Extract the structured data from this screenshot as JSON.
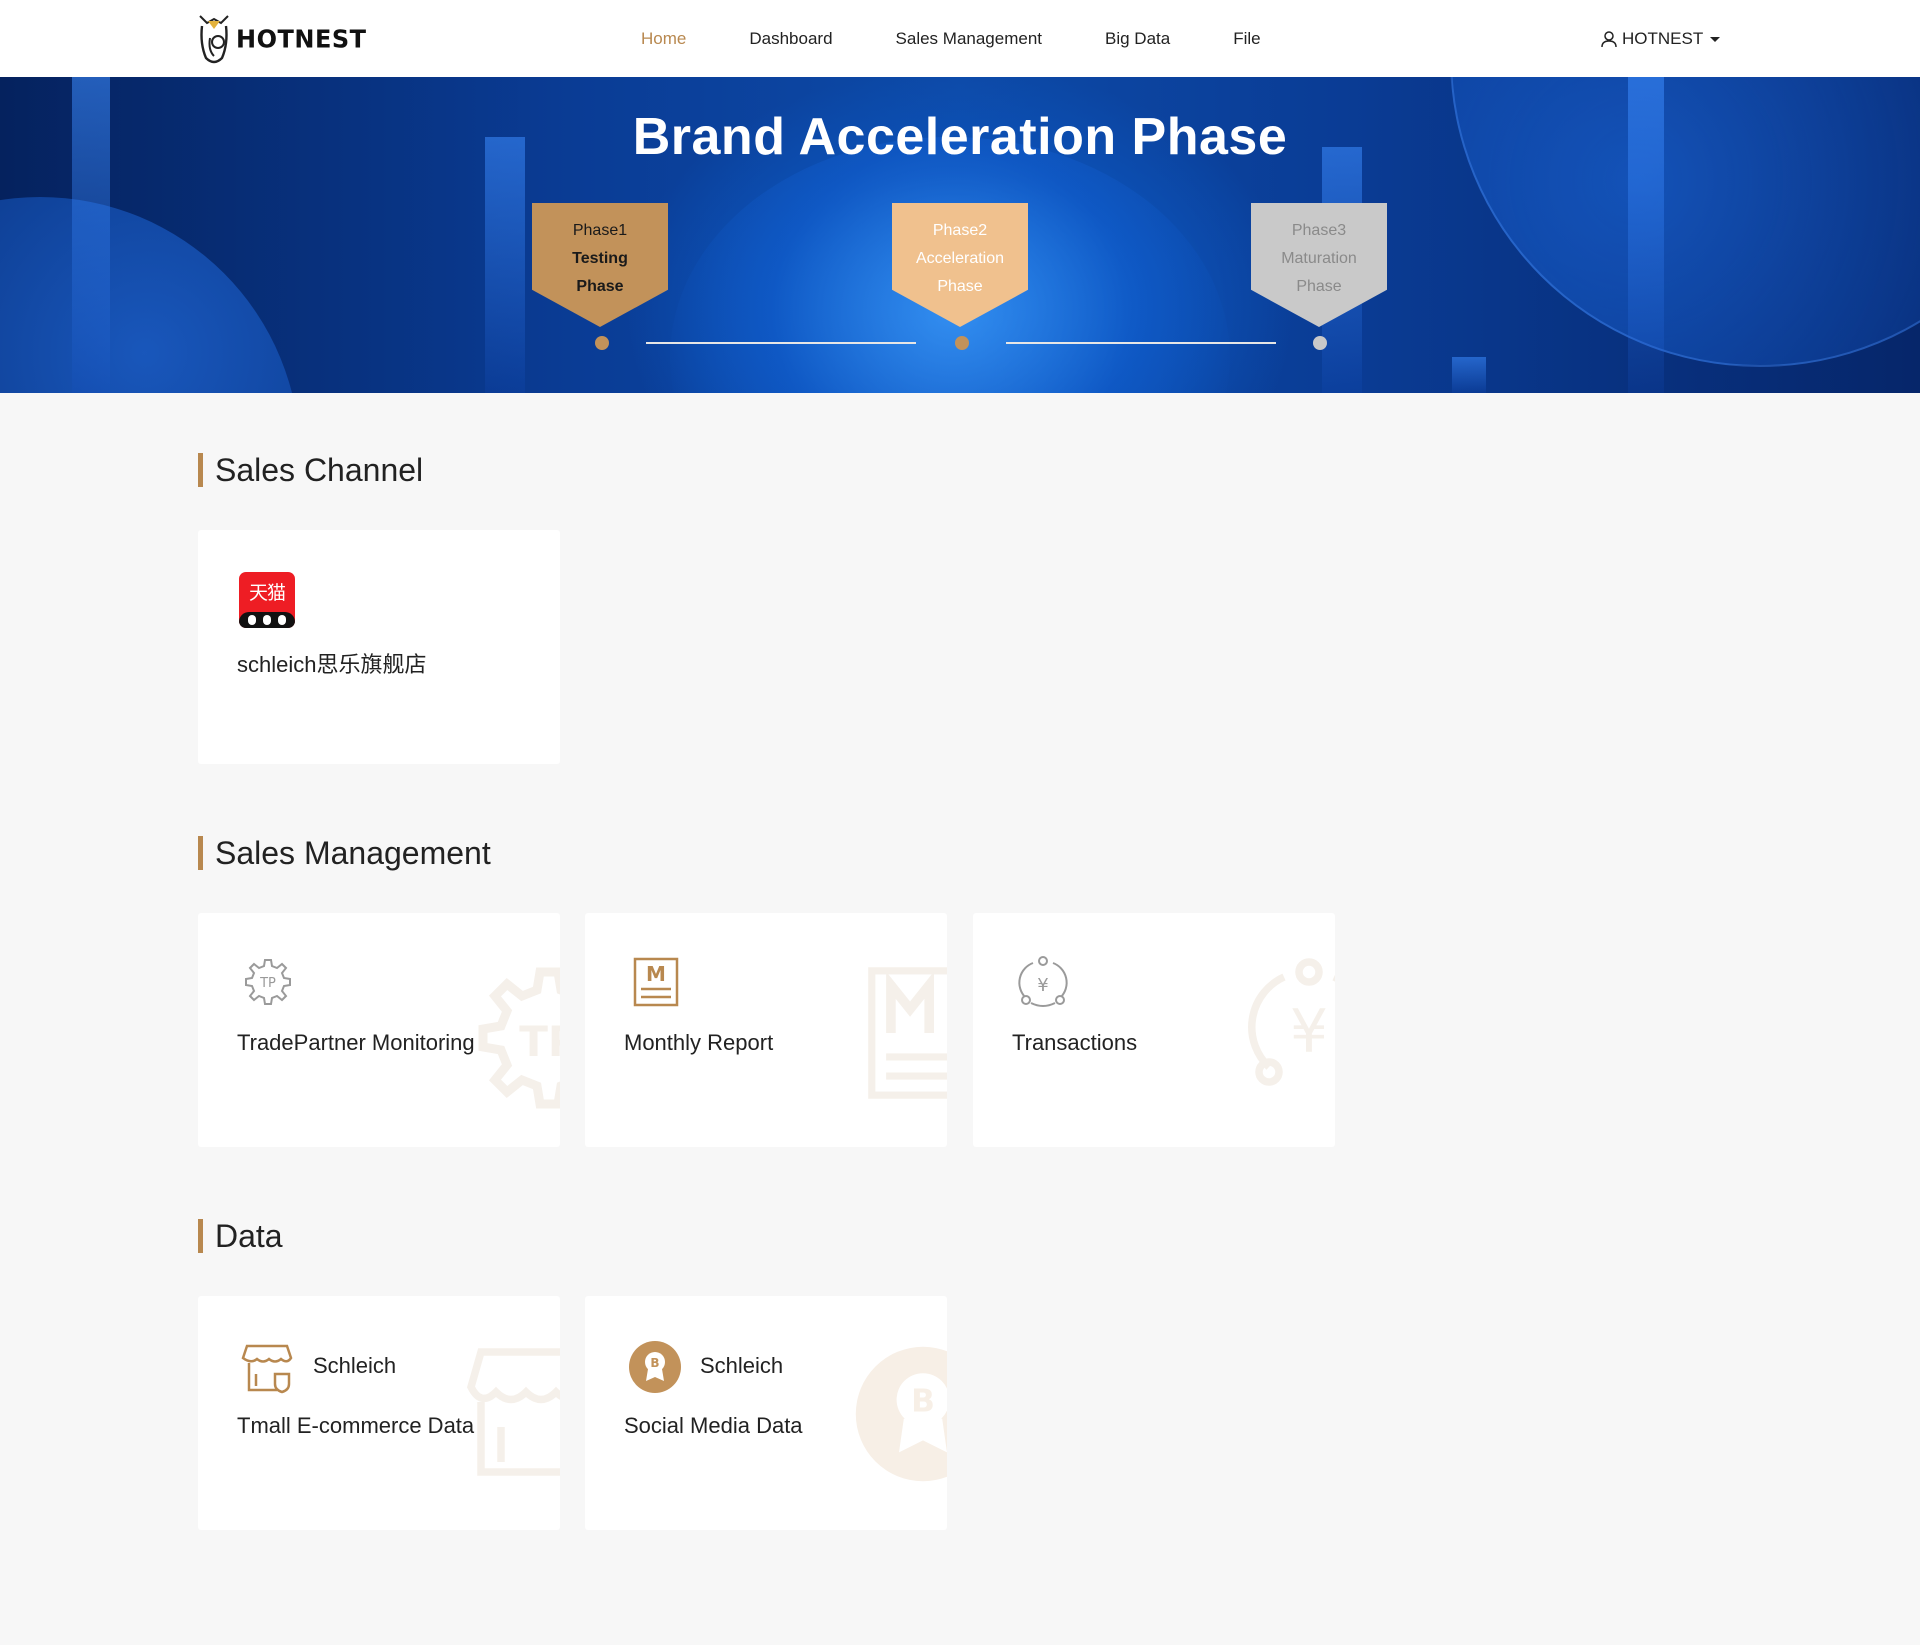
{
  "nav": {
    "logo_text": "HOTNEST",
    "links": [
      {
        "label": "Home",
        "active": true
      },
      {
        "label": "Dashboard"
      },
      {
        "label": "Sales Management"
      },
      {
        "label": "Big Data"
      },
      {
        "label": "File"
      }
    ],
    "user_label": "HOTNEST"
  },
  "hero": {
    "title": "Brand Acceleration Phase",
    "phases": [
      {
        "number": "Phase1",
        "name": "Testing",
        "suffix": "Phase"
      },
      {
        "number": "Phase2",
        "name": "Acceleration",
        "suffix": "Phase"
      },
      {
        "number": "Phase3",
        "name": "Maturation",
        "suffix": "Phase"
      }
    ]
  },
  "sections": {
    "sales_channel": {
      "title": "Sales Channel",
      "cards": [
        {
          "icon": "tmall-icon",
          "icon_text": "天猫",
          "label": "schleich思乐旗舰店"
        }
      ]
    },
    "sales_management": {
      "title": "Sales Management",
      "cards": [
        {
          "icon": "tp-gear-icon",
          "icon_text": "TP",
          "label": "TradePartner Monitoring"
        },
        {
          "icon": "monthly-report-icon",
          "icon_text": "M",
          "label": "Monthly Report"
        },
        {
          "icon": "transactions-yen-icon",
          "icon_text": "¥",
          "label": "Transactions"
        }
      ]
    },
    "data": {
      "title": "Data",
      "cards": [
        {
          "icon": "store-icon",
          "title": "Schleich",
          "label": "Tmall E-commerce Data"
        },
        {
          "icon": "social-badge-icon",
          "icon_text": "B",
          "title": "Schleich",
          "label": "Social Media Data"
        }
      ]
    }
  },
  "colors": {
    "accent": "#b8884f",
    "phase1": "#c2925a",
    "phase2": "#f0c18e",
    "phase3": "#c9c9c9",
    "tmall_red": "#ee1d24",
    "page_bg": "#f7f7f7"
  }
}
